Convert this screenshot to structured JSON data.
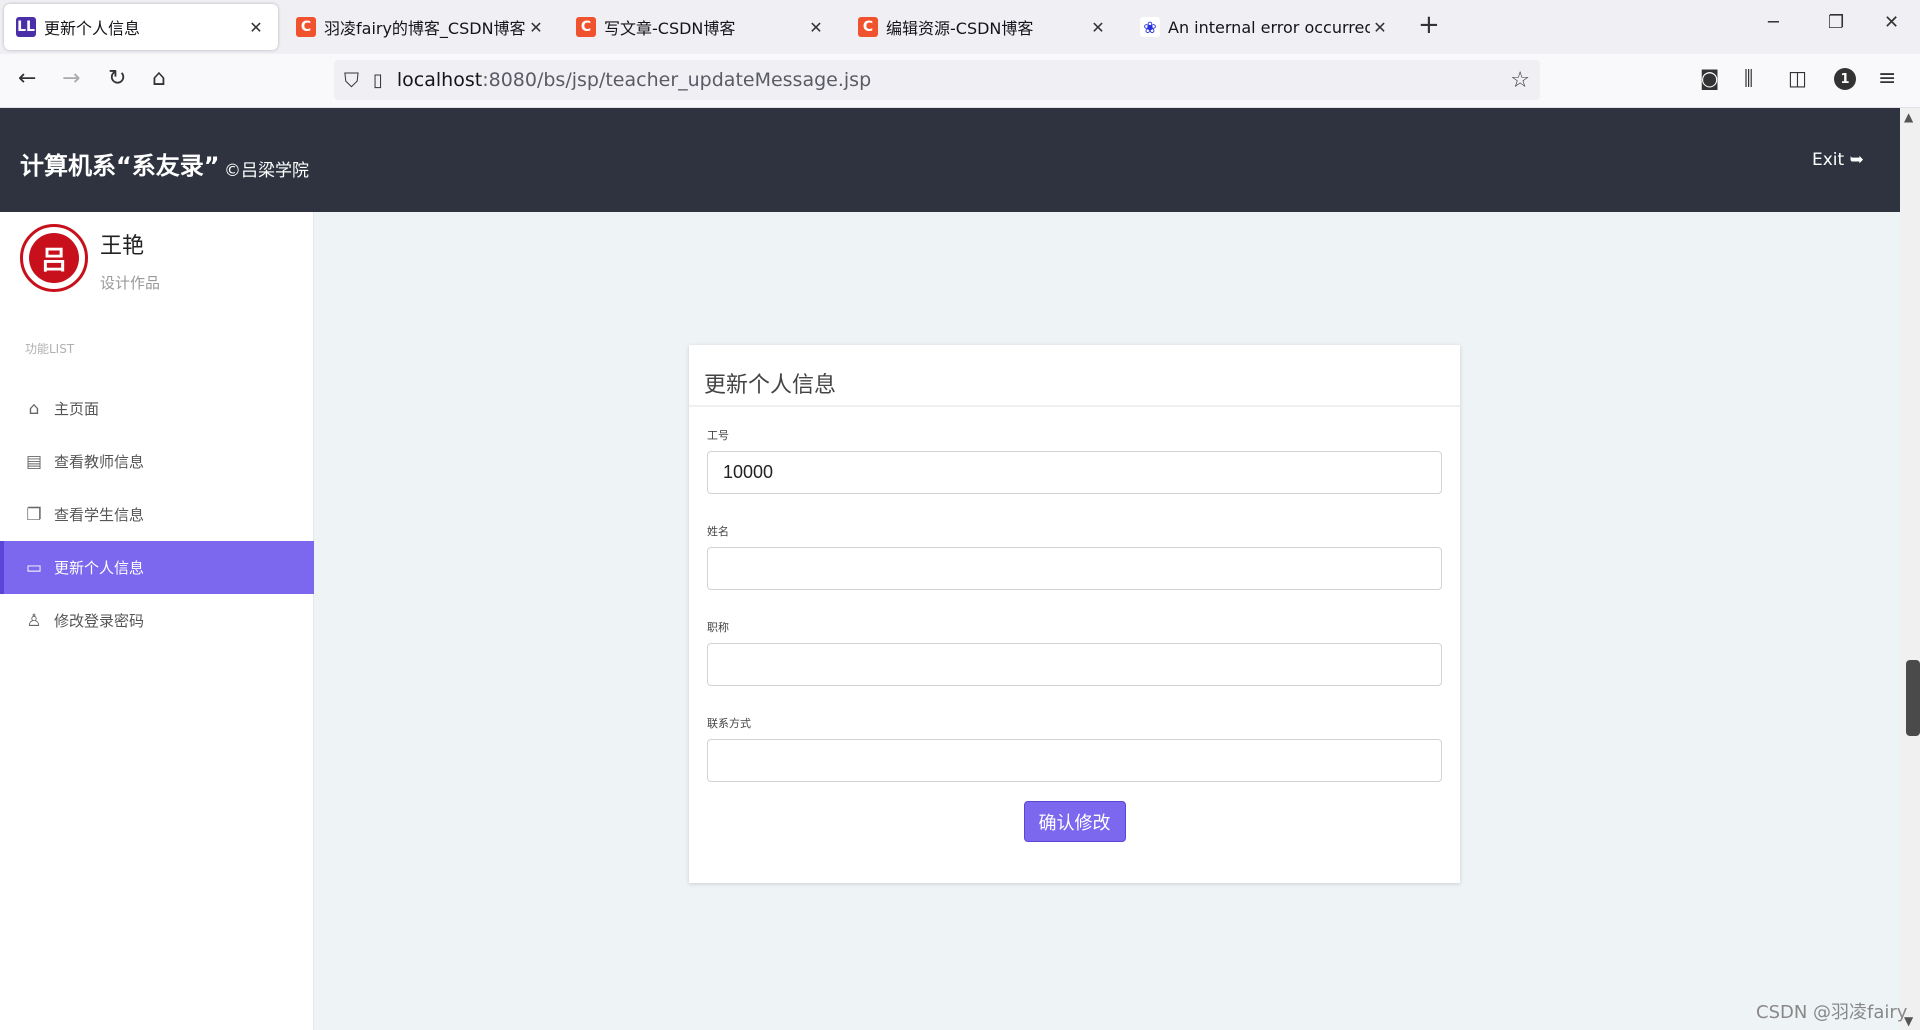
{
  "browser": {
    "tabs": [
      {
        "title": "更新个人信息",
        "favicon": "LL",
        "color": "#4b2fa8"
      },
      {
        "title": "羽凌fairy的博客_CSDN博客-计",
        "favicon": "C",
        "color": "#f0522e"
      },
      {
        "title": "写文章-CSDN博客",
        "favicon": "C",
        "color": "#f0522e"
      },
      {
        "title": "编辑资源-CSDN博客",
        "favicon": "C",
        "color": "#f0522e"
      },
      {
        "title": "An internal error occurred du",
        "favicon": "paw",
        "color": "#2932e1"
      }
    ],
    "url_host": "localhost",
    "url_path": ":8080/bs/jsp/teacher_updateMessage.jsp",
    "profile_badge": "1"
  },
  "header": {
    "brand": "计算机系“系友录”",
    "sub": "©吕梁学院",
    "exit_label": "Exit"
  },
  "sidebar": {
    "user_name": "王艳",
    "user_role": "设计作品",
    "section_title": "功能LIST",
    "items": [
      {
        "label": "主页面",
        "icon": "home-icon"
      },
      {
        "label": "查看教师信息",
        "icon": "document-icon"
      },
      {
        "label": "查看学生信息",
        "icon": "cards-icon"
      },
      {
        "label": "更新个人信息",
        "icon": "id-card-icon",
        "active": true
      },
      {
        "label": "修改登录密码",
        "icon": "user-icon"
      }
    ]
  },
  "form": {
    "title": "更新个人信息",
    "fields": {
      "id": {
        "label": "工号",
        "value": "10000"
      },
      "name": {
        "label": "姓名",
        "value": ""
      },
      "title": {
        "label": "职称",
        "value": ""
      },
      "contact": {
        "label": "联系方式",
        "value": ""
      }
    },
    "submit_label": "确认修改"
  },
  "watermark": "CSDN @羽凌fairy",
  "colors": {
    "accent": "#7b68ee",
    "header_bg": "#2e333f",
    "page_bg": "#eef3f6"
  }
}
